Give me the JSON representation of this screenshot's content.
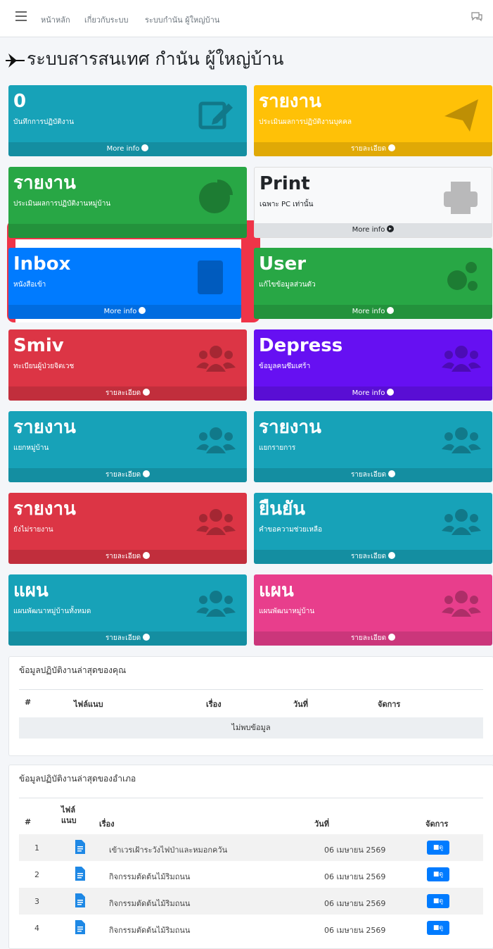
{
  "nav": {
    "items": [
      "หน้าหลัก",
      "เกี่ยวกับระบบ",
      "ระบบกำนัน ผู้ใหญ่บ้าน"
    ]
  },
  "page": {
    "title": "ระบบสารสนเทศ กำนัน ผู้ใหญ่บ้าน"
  },
  "boxes": [
    {
      "num": "0",
      "sub": "บันทึกการปฏิบัติงาน",
      "footer": "More info",
      "icon": "edit-icon",
      "color": "#17a2b8"
    },
    {
      "num": "รายงาน",
      "sub": "ประเมินผลการปฏิบัติงานบุคคล",
      "footer": "รายละเอียด",
      "icon": "paper-plane-icon",
      "color": "#ffc107"
    },
    {
      "num": "รายงาน",
      "sub": "ประเมินผลการปฏิบัติงานหมู่บ้าน",
      "footer": "",
      "icon": "pie-chart-icon",
      "color": "#28a745"
    },
    {
      "num": "Print",
      "sub": "เฉพาะ PC เท่านั้น",
      "footer": "More info",
      "icon": "print-icon",
      "color": "#f8f9fa"
    },
    {
      "num": "Inbox",
      "sub": "หนังสือเข้า",
      "footer": "More info",
      "icon": "book-icon",
      "color": "#007bff"
    },
    {
      "num": "User",
      "sub": "แก้ไขข้อมูลส่วนตัว",
      "footer": "More info",
      "icon": "gears-icon",
      "color": "#28a745"
    },
    {
      "num": "Smiv",
      "sub": "ทะเบียนผู้ป่วยจิตเวช",
      "footer": "รายละเอียด",
      "icon": "users-icon",
      "color": "#dc3545"
    },
    {
      "num": "Depress",
      "sub": "ข้อมูลคนซึมเศร้า",
      "footer": "More info",
      "icon": "users-icon",
      "color": "#6610f2"
    },
    {
      "num": "รายงาน",
      "sub": "แยกหมู่บ้าน",
      "footer": "รายละเอียด",
      "icon": "users-icon",
      "color": "#17a2b8"
    },
    {
      "num": "รายงาน",
      "sub": "แยกรายการ",
      "footer": "รายละเอียด",
      "icon": "users-icon",
      "color": "#17a2b8"
    },
    {
      "num": "รายงาน",
      "sub": "ยังไม่รายงาน",
      "footer": "รายละเอียด",
      "icon": "users-icon",
      "color": "#dc3545"
    },
    {
      "num": "ยืนยัน",
      "sub": "คำขอความช่วยเหลือ",
      "footer": "รายละเอียด",
      "icon": "users-icon",
      "color": "#17a2b8"
    },
    {
      "num": "แผน",
      "sub": "แผนพัฒนาหมู่บ้านทั้งหมด",
      "footer": "รายละเอียด",
      "icon": "users-icon",
      "color": "#17a2b8"
    },
    {
      "num": "แผน",
      "sub": "แผนพัฒนาหมู่บ้าน",
      "footer": "รายละเอียด",
      "icon": "users-icon",
      "color": "#e83e8c"
    }
  ],
  "my_table": {
    "title": "ข้อมูลปฏิบัติงานล่าสุดของคุณ",
    "headers": [
      "#",
      "ไฟล์แนบ",
      "เรื่อง",
      "วันที่",
      "จัดการ"
    ],
    "empty": "ไม่พบข้อมูล"
  },
  "district_table": {
    "title": "ข้อมูลปฏิบัติงานล่าสุดของอำเภอ",
    "headers": [
      "#",
      "ไฟล์ แนบ",
      "เรื่อง",
      "วันที่",
      "จัดการ"
    ],
    "manage_label": "ดู",
    "rows": [
      {
        "no": "1",
        "subject": "เข้าเวรเฝ้าระวังไฟป่าและหมอกควัน",
        "date": "06 เมษายน 2569"
      },
      {
        "no": "2",
        "subject": "กิจกรรมตัดต้นไม้ริมถนน",
        "date": "06 เมษายน 2569"
      },
      {
        "no": "3",
        "subject": "กิจกรรมตัดต้นไม้ริมถนน",
        "date": "06 เมษายน 2569"
      },
      {
        "no": "4",
        "subject": "กิจกรรมตัดต้นไม้ริมถนน",
        "date": "06 เมษายน 2569"
      }
    ]
  }
}
